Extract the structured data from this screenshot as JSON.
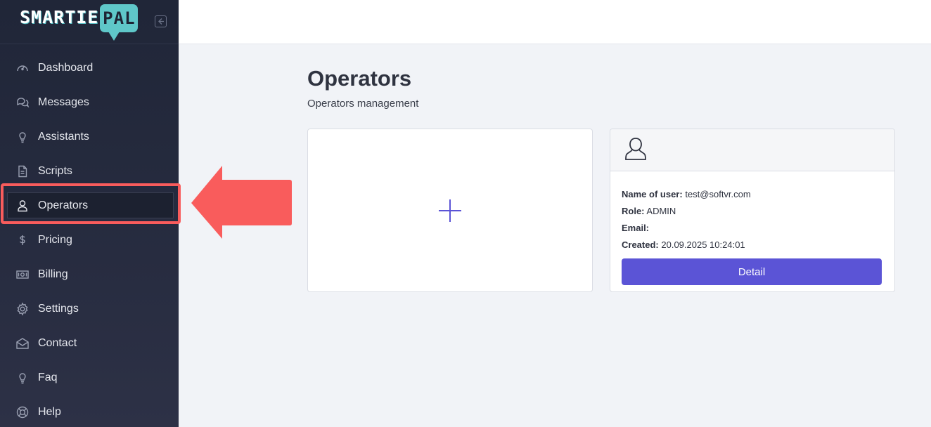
{
  "brand": {
    "logo_part1": "SMARTIE",
    "logo_part2": "PAL"
  },
  "sidebar": {
    "items": [
      {
        "label": "Dashboard",
        "icon": "dashboard-gauge-icon"
      },
      {
        "label": "Messages",
        "icon": "chat-bubbles-icon"
      },
      {
        "label": "Assistants",
        "icon": "lightbulb-icon"
      },
      {
        "label": "Scripts",
        "icon": "document-icon"
      },
      {
        "label": "Operators",
        "icon": "user-icon",
        "active": true
      },
      {
        "label": "Pricing",
        "icon": "dollar-icon"
      },
      {
        "label": "Billing",
        "icon": "cash-icon"
      },
      {
        "label": "Settings",
        "icon": "gear-icon"
      },
      {
        "label": "Contact",
        "icon": "envelope-icon"
      },
      {
        "label": "Faq",
        "icon": "lightbulb-icon"
      },
      {
        "label": "Help",
        "icon": "lifebuoy-icon"
      }
    ]
  },
  "main": {
    "title": "Operators",
    "subtitle": "Operators management",
    "operator_card": {
      "name_label": "Name of user:",
      "name_value": "test@softvr.com",
      "role_label": "Role:",
      "role_value": "ADMIN",
      "email_label": "Email:",
      "email_value": "",
      "created_label": "Created:",
      "created_value": "20.09.2025 10:24:01",
      "detail_button": "Detail"
    }
  },
  "colors": {
    "accent": "#5b54d6",
    "annotation": "#f95c5c",
    "sidebar_bg": "#232839"
  }
}
